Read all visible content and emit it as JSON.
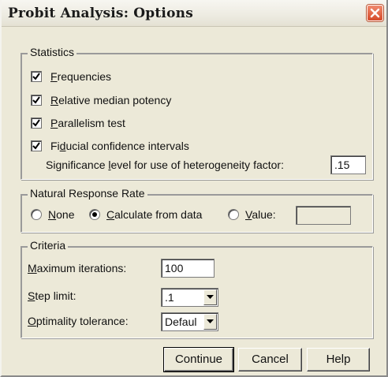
{
  "window": {
    "title": "Probit Analysis: Options"
  },
  "statistics": {
    "legend": "Statistics",
    "frequencies": {
      "prefix": "",
      "accel": "F",
      "rest": "requencies",
      "checked": true
    },
    "relative_median_potency": {
      "prefix": "",
      "accel": "R",
      "rest": "elative median potency",
      "checked": true
    },
    "parallelism_test": {
      "prefix": "",
      "accel": "P",
      "rest": "arallelism test",
      "checked": true
    },
    "fiducial": {
      "prefix": "Fi",
      "accel": "d",
      "rest": "ucial confidence intervals",
      "checked": true
    },
    "significance": {
      "prefix": "Significance ",
      "accel": "l",
      "rest": "evel for use of heterogeneity factor:",
      "value": ".15"
    }
  },
  "natural_response": {
    "legend": "Natural Response Rate",
    "none": {
      "prefix": "",
      "accel": "N",
      "rest": "one",
      "selected": false
    },
    "calculate": {
      "prefix": "",
      "accel": "C",
      "rest": "alculate from data",
      "selected": true
    },
    "value": {
      "prefix": "",
      "accel": "V",
      "rest": "alue:",
      "selected": false,
      "field_value": ""
    }
  },
  "criteria": {
    "legend": "Criteria",
    "max_iterations": {
      "prefix": "",
      "accel": "M",
      "rest": "aximum iterations:",
      "value": "100"
    },
    "step_limit": {
      "prefix": "",
      "accel": "S",
      "rest": "tep limit:",
      "value": ".1"
    },
    "optimality": {
      "prefix": "",
      "accel": "O",
      "rest": "ptimality tolerance:",
      "value": "Defaul"
    }
  },
  "buttons": {
    "continue": "Continue",
    "cancel": "Cancel",
    "help": "Help"
  },
  "icons": {
    "close": "close-icon",
    "check": "checkmark-icon",
    "dropdown": "chevron-down-icon"
  },
  "colors": {
    "face": "#ece9d8",
    "close_button": "#d54a2a"
  }
}
